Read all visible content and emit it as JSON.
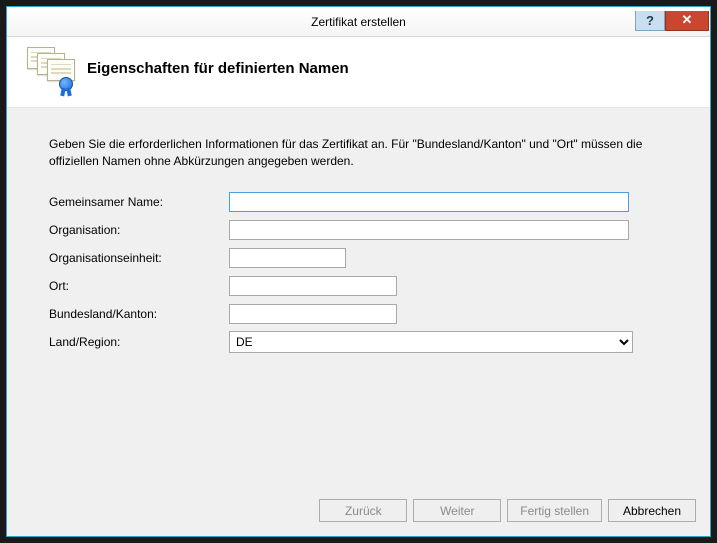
{
  "window": {
    "title": "Zertifikat erstellen"
  },
  "header": {
    "heading": "Eigenschaften für definierten Namen"
  },
  "description": "Geben Sie die erforderlichen Informationen für das Zertifikat an. Für \"Bundesland/Kanton\" und \"Ort\" müssen die offiziellen Namen ohne Abkürzungen angegeben werden.",
  "labels": {
    "common_name": "Gemeinsamer Name:",
    "organisation": "Organisation:",
    "org_unit": "Organisationseinheit:",
    "city": "Ort:",
    "state": "Bundesland/Kanton:",
    "country": "Land/Region:"
  },
  "values": {
    "common_name": "",
    "organisation": "",
    "org_unit": "",
    "city": "",
    "state": "",
    "country": "DE"
  },
  "buttons": {
    "back": "Zurück",
    "next": "Weiter",
    "finish": "Fertig stellen",
    "cancel": "Abbrechen"
  }
}
